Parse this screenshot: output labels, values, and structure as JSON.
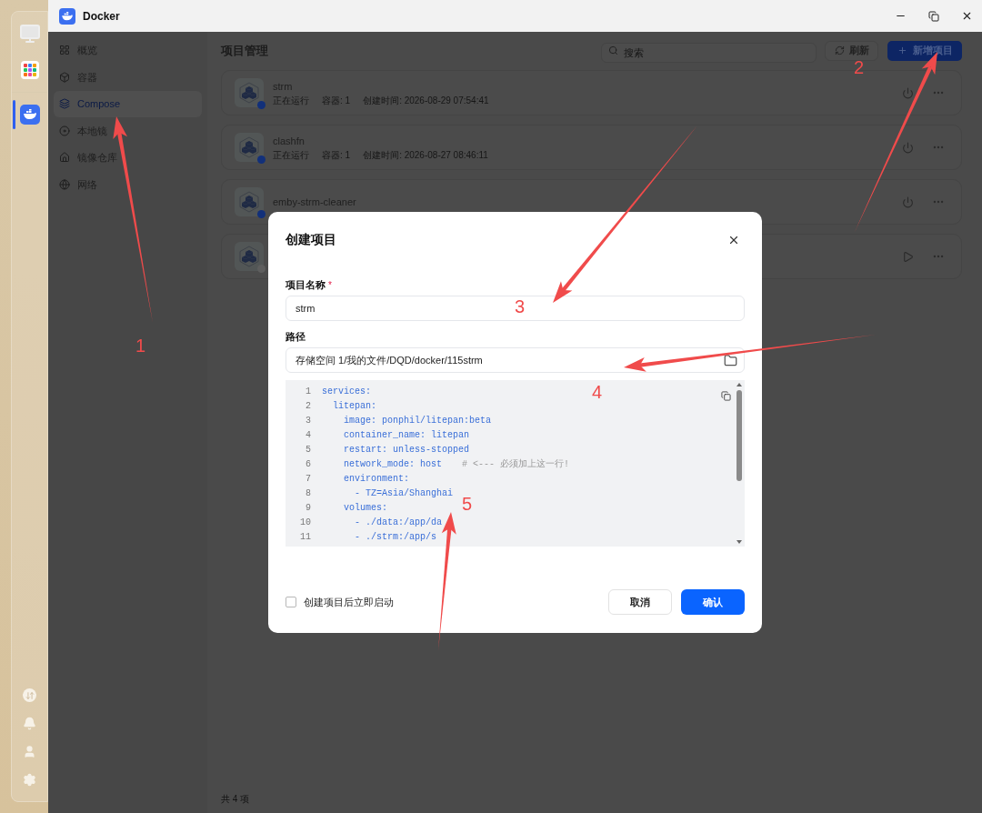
{
  "dock": {
    "items": [
      {
        "kind": "monitor",
        "selected": false
      },
      {
        "kind": "apps",
        "selected": false
      },
      {
        "kind": "docker",
        "selected": true
      }
    ],
    "bottom_items": [
      {
        "kind": "transfer"
      },
      {
        "kind": "bell"
      },
      {
        "kind": "user"
      },
      {
        "kind": "settings"
      }
    ]
  },
  "window": {
    "title": "Docker"
  },
  "sidebar": {
    "items": [
      {
        "label": "概览",
        "selected": false
      },
      {
        "label": "容器",
        "selected": false
      },
      {
        "label": "Compose",
        "selected": true
      },
      {
        "label": "本地镜",
        "selected": false
      },
      {
        "label": "镜像仓库",
        "selected": false
      },
      {
        "label": "网络",
        "selected": false
      }
    ]
  },
  "main": {
    "title": "项目管理",
    "search": {
      "placeholder": "搜索"
    },
    "refresh_button": "刷新",
    "add_button": "新增项目",
    "projects": [
      {
        "name": "strm",
        "status": "正在运行",
        "containers": "容器: 1",
        "created": "创建时间: 2026-08-29 07:54:41",
        "running": true
      },
      {
        "name": "clashfn",
        "status": "正在运行",
        "containers": "容器: 1",
        "created": "创建时间: 2026-08-27 08:46:11",
        "running": true
      },
      {
        "name": "emby-strm-cleaner",
        "running": true
      },
      {
        "running": false
      }
    ],
    "footer": "共 4 项"
  },
  "dialog": {
    "title": "创建项目",
    "name_label": "项目名称",
    "required_mark": "*",
    "name_value": "strm",
    "path_label": "路径",
    "path_value": "存储空间 1/我的文件/DQD/docker/115strm",
    "code_lines": [
      {
        "number": "1",
        "code": "services:"
      },
      {
        "number": "2",
        "code": "  litepan:"
      },
      {
        "number": "3",
        "code": "    image: ponphil/litepan:beta"
      },
      {
        "number": "4",
        "code": "    container_name: litepan"
      },
      {
        "number": "5",
        "code": "    restart: unless-stopped"
      },
      {
        "number": "6",
        "code": "    network_mode: host",
        "comment": "# <--- 必须加上这一行!"
      },
      {
        "number": "7",
        "code": "    environment:"
      },
      {
        "number": "8",
        "code": "      - TZ=Asia/Shanghai"
      },
      {
        "number": "9",
        "code": "    volumes:"
      },
      {
        "number": "10",
        "code": "      - ./data:/app/da"
      },
      {
        "number": "11",
        "code": "      - ./strm:/app/s"
      }
    ],
    "autostart": {
      "label": "创建项目后立即启动",
      "checked": false
    },
    "cancel_button": "取消",
    "confirm_button": "确认"
  },
  "annotations": [
    {
      "label": "1"
    },
    {
      "label": "2"
    },
    {
      "label": "3"
    },
    {
      "label": "4"
    },
    {
      "label": "5"
    }
  ]
}
